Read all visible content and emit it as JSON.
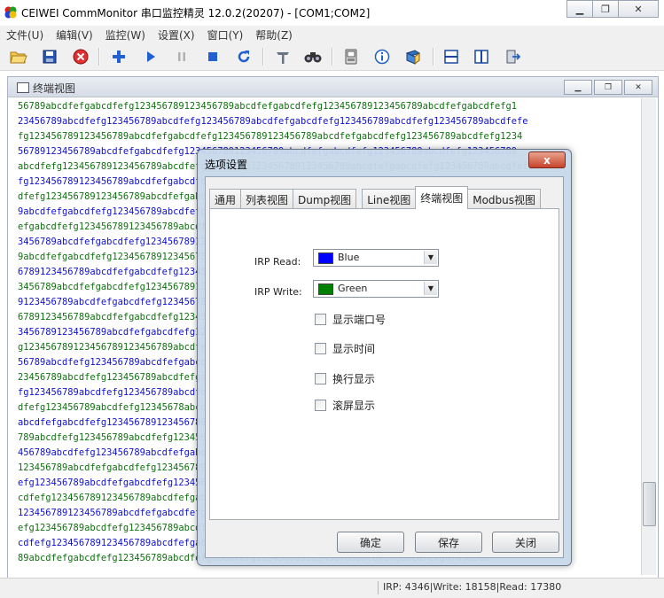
{
  "window": {
    "title": "CEIWEI CommMonitor 串口监控精灵 12.0.2(20207) - [COM1;COM2]",
    "controls": [
      "▁",
      "❐",
      "✕"
    ]
  },
  "menubar": [
    "文件(U)",
    "编辑(V)",
    "监控(W)",
    "设置(X)",
    "窗口(Y)",
    "帮助(Z)"
  ],
  "toolbar": {
    "icons": [
      "open-folder-icon",
      "save-icon",
      "stop-circle-icon",
      "add-icon",
      "play-icon",
      "pause-icon",
      "stop-icon",
      "refresh-icon",
      "settings-icon",
      "search-binoculars-icon",
      "device-icon",
      "info-icon",
      "book-icon",
      "horizontal-split-icon",
      "vertical-split-icon",
      "exit-icon"
    ]
  },
  "child_window": {
    "title": "终端视图",
    "controls": [
      "▁",
      "❐",
      "✕"
    ]
  },
  "terminal": {
    "lines": [
      "56789abcdfefgabcdfefg123456789123456789abcdfefgabcdfefg123456789123456789abcdfefgabcdfefg1",
      "23456789abcdfefg123456789abcdfefg123456789abcdfefgabcdfefg123456789abcdfefg123456789abcdfefe",
      "fg123456789123456789abcdfefgabcdfefg123456789123456789abcdfefgabcdfefg123456789abcdfefg1234",
      "56789123456789abcdfefgabcdfefg123456789123456789abcdfefgabcdfefg123456789abcdfefg123456789",
      "abcdfefg123456789123456789abcdfefgabcdfefg123456789123456789abcdfefgabcdfefg123456789abcdfefe",
      "fg123456789123456789abcdfefgabcdfefg123456789123456789abcdfefgabcdfefg123456789123456789abc",
      "dfefg123456789123456789abcdfefgabcdfefg123456789123456789abcdfefgabcdfefg1234567891234567 8",
      "9abcdfefgabcdfefg123456789abcdfefgabcdfefg123456789123456789abcdfefgabcdfefg123456789abcdf",
      "efgabcdfefg123456789123456789abcdfefgabcdfefg123456789123456789abcdfefgabcdfefg123456789",
      "3456789abcdfefgabcdfefg123456789123456789abcdfefgabcdfefg123456789123456789abcdfefg12345678",
      "9abcdfefgabcdfefg123456789123456789abcdfefgabcdfefg123456789123456789abcdfefg6789123456789",
      "6789123456789abcdfefgabcdfefg123456789abcdfefgabcdfefg123456789123456789abcdfefgabcdfefg12",
      "3456789abcdfefgabcdfefg123456789123456789abcdfefgabcdfefg123456789123456789abcdfeg12345678",
      "9123456789abcdfefgabcdfefg123456789123456789abcdfefgabcdfefg123456789123456789abcdfefg12345",
      "6789123456789abcdfefgabcdfefg123456789abcdfefgabcdfefg123456789123456789abcdfefgabcdfefg12",
      "3456789123456789abcdfefgabcdfefg123456789123456789abcdfefgabcdfefg123456789123456gabcdfef",
      "g123456789123456789123456789abcdfefgabcdfefg123456789123456789abcdfefgabcdfefg123456781234",
      "56789abcdfefg123456789abcdfefgabcdfefg123456789123456789abcdfefgabcdfefg123456789abcdfefg1",
      "23456789abcdfefg123456789abcdfefgabcdfefg123456789123456789abcdfefgabcdfefg123456789abcdfe",
      "fg123456789abcdfefg123456789abcdfefgabcdfefg123456789123456789abcdfefgabcdfe3456789abc",
      "dfefg123456789abcdfefg12345678abcdfefgabcdfefg123456789123456789abcdfefgabcdfefg123456789",
      "abcdfefgabcdfefg123456789123456789abcdfefgabcdfefg123456789123456789abcdfefga6789123456",
      "789abcdfefg123456789abcdfefg123456789abcdfefgabcdfefg123456789123456789abcdfefgfefg123",
      "456789abcdfefg123456789abcdfefgabcdfefg123456789123456789abcdfefgabcdfefg123456789abcdfe",
      "123456789abcdfefgabcdfefg123456789123456789abcdfefgabcdfefg123456789123456789f6789abcdfe",
      "efg123456789abcdfefgabcdfefg123456789123456789abcdfefgabcdfefg123456789123456723456789ab",
      "cdfefg123456789123456789abcdfefgabcdfefg123456789123456789abcdfefgabcdfefg123456789abcdfefg",
      "123456789123456789abcdfefgabcdfefg123456789123456789abcdfefgabcdfefg12345678fgabcdfef",
      "efg123456789abcdfefg123456789abcdfefgabcdfefg123456789123456789abcdfefgabcdfefg123456789abcd",
      "cdfefg123456789123456789abcdfefgabcdfefg123456789123456789abcdfefgabcdfefg89123456 7",
      "89abcdfefgabcdfefg123456789abcdfefgabcdfefg123456789123456789abcdfefgabcdfefg6789abcd"
    ]
  },
  "status": {
    "text": "IRP: 4346|Write: 18158|Read: 17380"
  },
  "dialog": {
    "title": "选项设置",
    "close": "x",
    "tabs": [
      "通用",
      "列表视图",
      "Dump视图",
      "Line视图",
      "终端视图",
      "Modbus视图"
    ],
    "active_tab": "终端视图",
    "irp_read_label": "IRP Read:",
    "irp_read_value": "Blue",
    "irp_read_color": "#0000ff",
    "irp_write_label": "IRP Write:",
    "irp_write_value": "Green",
    "irp_write_color": "#008000",
    "checkboxes": [
      "显示端口号",
      "显示时间",
      "换行显示",
      "滚屏显示"
    ],
    "ok_label": "确定",
    "save_label": "保存",
    "close_label": "关闭"
  },
  "colors": {
    "terminal_blue": "#1010d0",
    "terminal_green": "#107010"
  }
}
